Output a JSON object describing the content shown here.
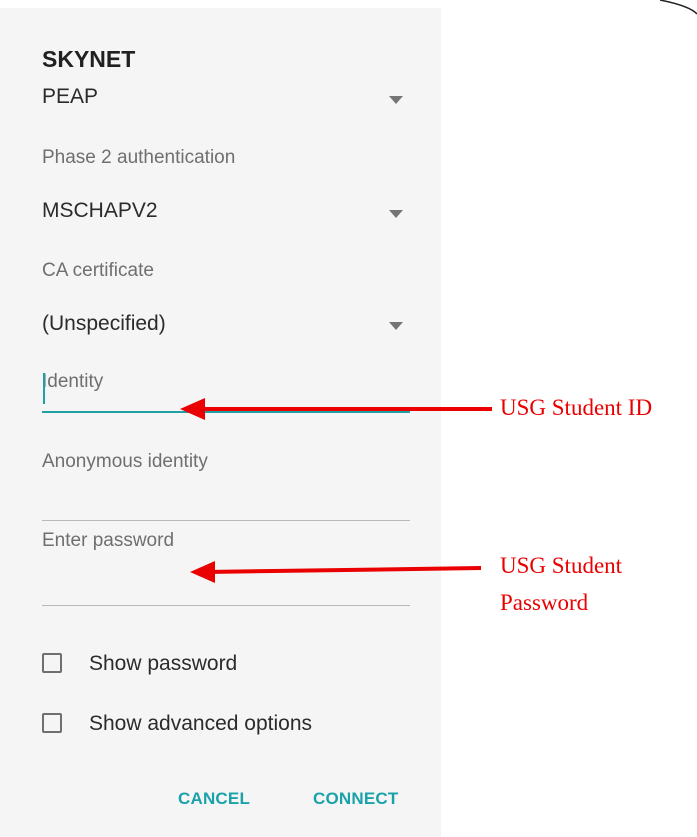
{
  "dialog": {
    "title": "SKYNET",
    "eap_method": {
      "value": "PEAP"
    },
    "phase2": {
      "label": "Phase 2 authentication",
      "value": "MSCHAPV2"
    },
    "ca_certificate": {
      "label": "CA certificate",
      "value": "(Unspecified)"
    },
    "identity": {
      "label": "Identity",
      "value": ""
    },
    "anonymous_identity": {
      "label": "Anonymous identity",
      "value": ""
    },
    "password": {
      "label": "Enter password",
      "value": ""
    },
    "show_password": {
      "label": "Show password",
      "checked": false
    },
    "show_advanced": {
      "label": "Show advanced options",
      "checked": false
    },
    "buttons": {
      "cancel": "CANCEL",
      "connect": "CONNECT"
    }
  },
  "annotations": {
    "identity_note": "USG Student ID",
    "password_note_line1": "USG Student",
    "password_note_line2": "Password"
  },
  "colors": {
    "accent": "#1ea0a4",
    "annotation": "#ea0000",
    "dialog_background": "#f5f5f5"
  },
  "icons": {
    "dropdown": "triangle-down-icon",
    "arrow": "left-arrow-icon"
  }
}
